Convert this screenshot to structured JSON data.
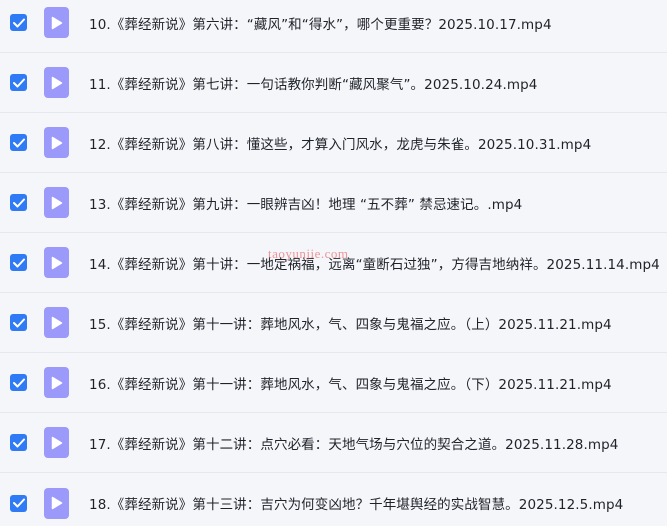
{
  "colors": {
    "checkbox": "#2f7bf5",
    "video_icon": "#9b99fa",
    "background": "#f5f6fa",
    "text": "#1f2329"
  },
  "icons": {
    "checkbox": "checkbox-checked-icon",
    "file": "video-play-icon"
  },
  "files": [
    {
      "name": "10.《葬经新说》第六讲：“藏风”和“得水”，哪个更重要？2025.10.17.mp4",
      "checked": true
    },
    {
      "name": "11.《葬经新说》第七讲：一句话教你判断“藏风聚气”。2025.10.24.mp4",
      "checked": true
    },
    {
      "name": "12.《葬经新说》第八讲：懂这些，才算入门风水，龙虎与朱雀。2025.10.31.mp4",
      "checked": true
    },
    {
      "name": "13.《葬经新说》第九讲：一眼辨吉凶！地理 “五不葬” 禁忌速记。.mp4",
      "checked": true
    },
    {
      "name": "14.《葬经新说》第十讲：一地定祸福，远离“童断石过独”，方得吉地纳祥。2025.11.14.mp4",
      "checked": true
    },
    {
      "name": "15.《葬经新说》第十一讲：葬地风水，气、四象与鬼福之应。（上）2025.11.21.mp4",
      "checked": true
    },
    {
      "name": "16.《葬经新说》第十一讲：葬地风水，气、四象与鬼福之应。（下）2025.11.21.mp4",
      "checked": true
    },
    {
      "name": "17.《葬经新说》第十二讲：点穴必看：天地气场与穴位的契合之道。2025.11.28.mp4",
      "checked": true
    },
    {
      "name": "18.《葬经新说》第十三讲：吉穴为何变凶地？千年堪舆经的实战智慧。2025.12.5.mp4",
      "checked": true
    }
  ],
  "watermark": "taoyunjie.com"
}
